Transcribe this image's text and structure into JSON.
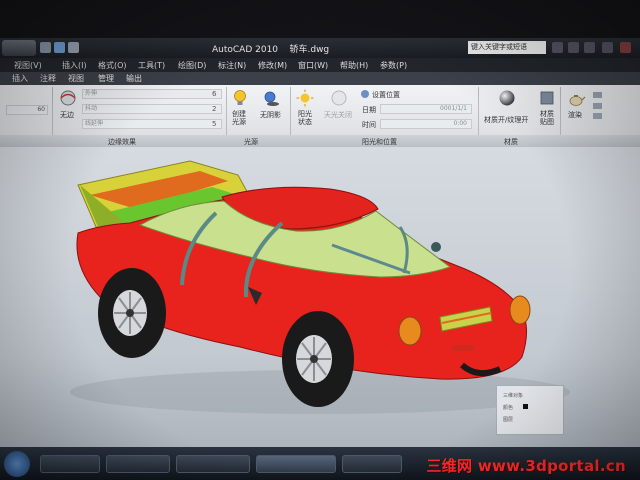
{
  "window": {
    "title": "AutoCAD 2010",
    "drawing_name": "轿车.dwg",
    "search_placeholder": "键入关键字或短语"
  },
  "menu": {
    "items": [
      "视图(V)",
      "插入(I)",
      "格式(O)",
      "工具(T)",
      "绘图(D)",
      "标注(N)",
      "修改(M)",
      "窗口(W)",
      "帮助(H)",
      "参数(P)"
    ]
  },
  "ribbon_tabs": {
    "items": [
      "插入",
      "注释",
      "视图",
      "管理",
      "输出"
    ]
  },
  "ribbon": {
    "field_60": "60",
    "style_none": "无边",
    "row1_label": "外伸",
    "row1_value": "6",
    "row2_label": "抖动",
    "row2_value": "2",
    "row3_label": "线延伸",
    "row3_value": "5",
    "create_light": "创建\n光源",
    "no_shadow": "无阴影",
    "sun_status": "阳光\n状态",
    "sky_off": "天光关闭",
    "set_location": "设置位置",
    "date_label": "日期",
    "date_value": "0001/1/1",
    "time_label": "时间",
    "time_value": "0:00",
    "materials_toggle": "材质开/纹理开",
    "materials_map": "材质\n贴图",
    "render": "渲染",
    "panel_edges": "边缘效果",
    "panel_lights": "光源",
    "panel_sun": "阳光和位置",
    "panel_materials": "材质"
  },
  "palette": {
    "title": "三维对象",
    "row1": "颜色",
    "row2": "图层"
  },
  "watermark": "三维网 www.3dportal.cn",
  "colors": {
    "car_body": "#e8221c",
    "car_top": "#c9e08e",
    "spoiler_yellow": "#d7d23a",
    "spoiler_orange": "#e06a1d",
    "spoiler_green": "#6ac62e",
    "tire": "#1a1a1a",
    "rim": "#d6d8dc",
    "viewport_bg": "#cdd3da",
    "ribbon_bg": "#e7e9ec",
    "taskbar": "#1b222c"
  },
  "icons": [
    "application-menu-icon",
    "save-icon",
    "undo-icon",
    "lightbulb-icon",
    "shadow-icon",
    "sun-icon",
    "sky-icon",
    "material-sphere-icon",
    "teapot-render-icon"
  ]
}
